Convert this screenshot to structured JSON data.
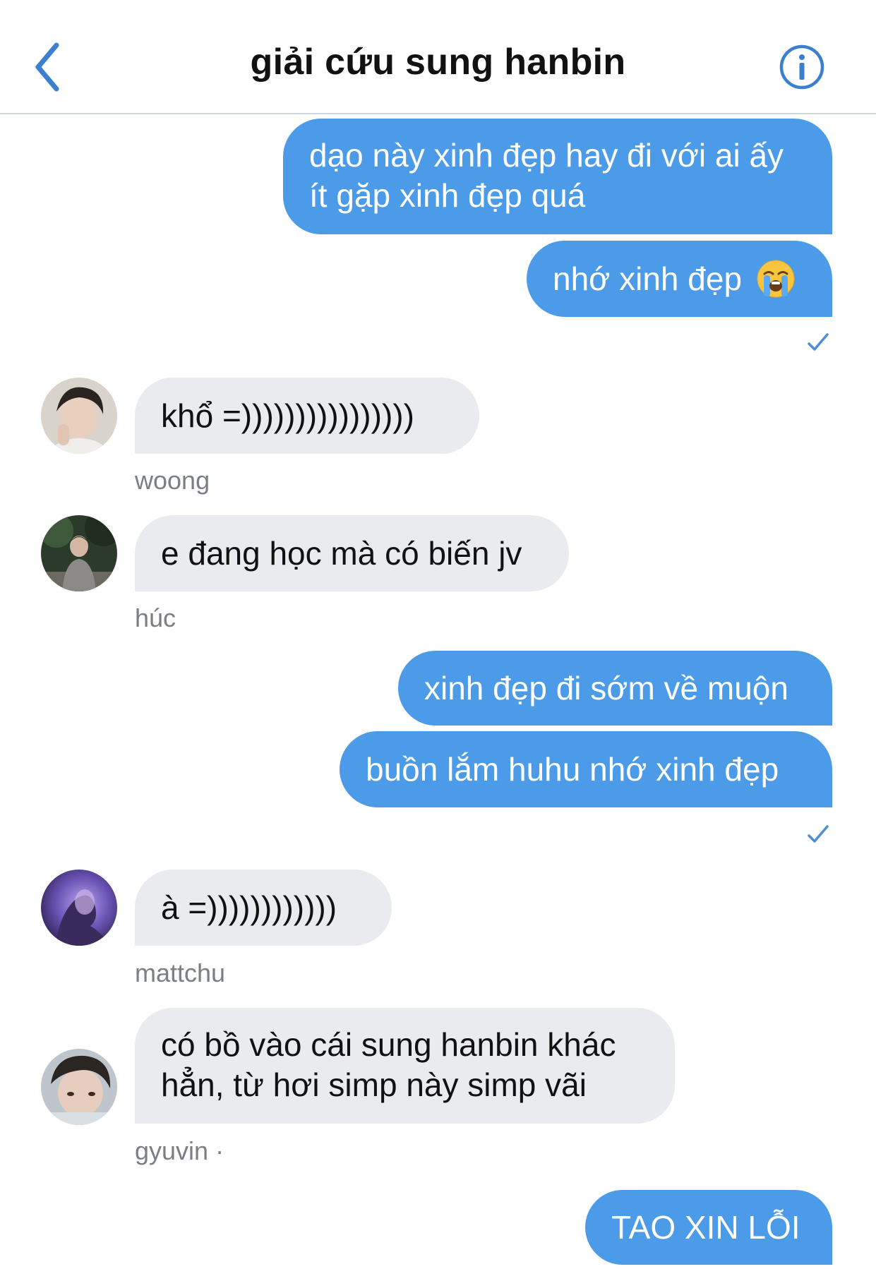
{
  "header": {
    "title": "giải cứu sung hanbin",
    "back_icon": "chevron-left-icon",
    "info_icon": "info-icon"
  },
  "colors": {
    "accent": "#4b9be8",
    "incoming_bubble": "#e9ebee",
    "sender_text": "#7b7f85"
  },
  "messages": [
    {
      "direction": "out",
      "lines": [
        "dạo này xinh đẹp hay đi với ai ấy",
        "ít gặp xinh đẹp quá"
      ]
    },
    {
      "direction": "out",
      "text": "nhớ xinh đẹp",
      "emoji": "loudly-crying-face-emoji",
      "read": true
    },
    {
      "direction": "in",
      "sender": "woong",
      "text": "khổ =))))))))))))))))"
    },
    {
      "direction": "in",
      "sender": "húc",
      "text": "e đang học mà có biến jv"
    },
    {
      "direction": "out",
      "text": "xinh đẹp đi sớm về muộn"
    },
    {
      "direction": "out",
      "text": "buồn lắm huhu nhớ xinh đẹp",
      "read": true
    },
    {
      "direction": "in",
      "sender": "mattchu",
      "text": "à =))))))))))))"
    },
    {
      "direction": "in",
      "sender": "gyuvin ·",
      "lines": [
        "có bồ vào cái sung hanbin khác",
        "hẳn, từ hơi simp này simp vãi"
      ]
    },
    {
      "direction": "out",
      "text": "TAO XIN LỖI"
    }
  ]
}
